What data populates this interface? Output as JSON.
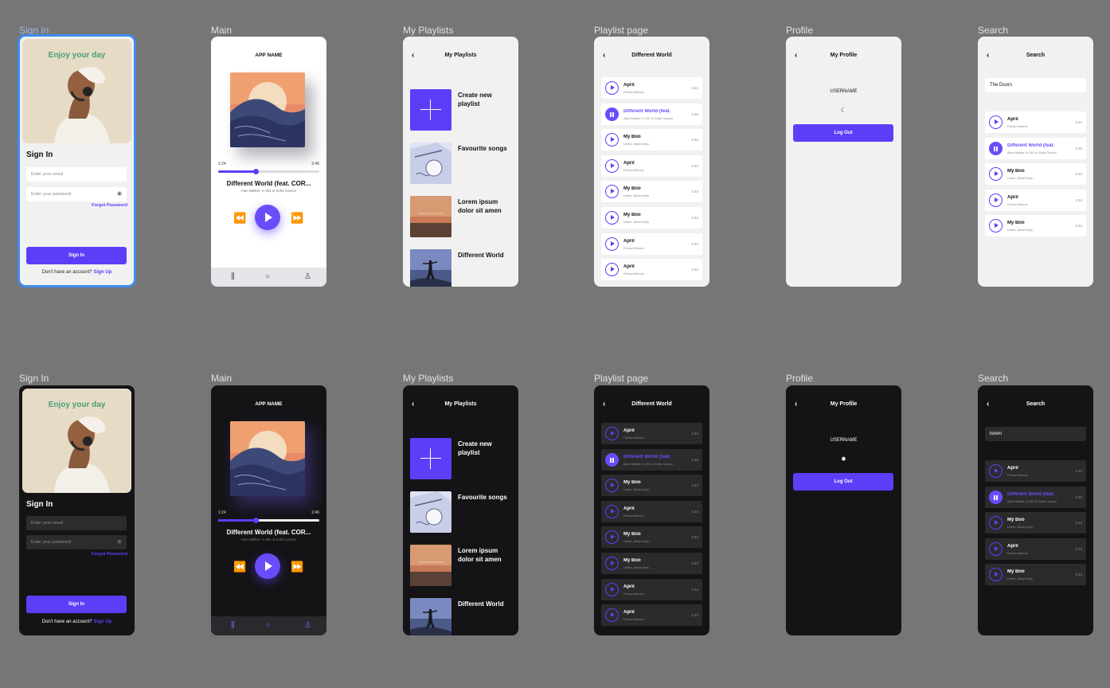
{
  "colors": {
    "accent": "#5b3ff8",
    "canvas": "#767676",
    "light_bg": "#f1f1f2",
    "dark_bg": "#141416"
  },
  "frame_labels": {
    "sign_in": "Sign In",
    "main": "Main",
    "my_playlists": "My Playlists",
    "playlist_page": "Playlist page",
    "profile": "Profile",
    "search": "Search"
  },
  "signin": {
    "hero_text": "Enjoy your day",
    "title": "Sign In",
    "email_placeholder": "Enter your email",
    "password_placeholder": "Enter your password",
    "forgot": "Forgot Password",
    "button": "Sign In",
    "no_account": "Don't have an account?",
    "signup": "Sign Up"
  },
  "main": {
    "app_name": "APP NAME",
    "elapsed": "1:24",
    "duration": "2:46",
    "progress": 0.37,
    "song_title": "Different World (feat. COR...",
    "song_artist": "Alan Walker, K-391 & Sofia Carson",
    "tabs": [
      "library-icon",
      "search-icon",
      "profile-icon"
    ]
  },
  "playlists": {
    "title": "My Playlists",
    "items": [
      "Create new playlist",
      "Favourite songs",
      "Lorem ipsum dolor sit amen",
      "Different World"
    ]
  },
  "playlist_page": {
    "title": "Different World",
    "tracks": [
      {
        "title": "April",
        "artist": "Fienso Bersori",
        "dur": "4:24"
      },
      {
        "title": "Different World (feat.",
        "artist": "Alan Walker, K-391 & Sofia Carson",
        "dur": "2:46",
        "active": true
      },
      {
        "title": "My Boo",
        "artist": "Usher, Alicia Keys",
        "dur": "3:43"
      },
      {
        "title": "April",
        "artist": "Fienso Bersori",
        "dur": "4:24"
      },
      {
        "title": "My Boo",
        "artist": "Usher, Alicia Keys",
        "dur": "3:43"
      },
      {
        "title": "My Boo",
        "artist": "Usher, Alicia Keys",
        "dur": "3:43"
      },
      {
        "title": "April",
        "artist": "Fienso Bersori",
        "dur": "4:24"
      },
      {
        "title": "April",
        "artist": "Fienso Bersori",
        "dur": "4:24"
      }
    ]
  },
  "profile": {
    "title": "My Profile",
    "username": "USERNAME",
    "logout": "Log Out"
  },
  "search": {
    "title": "Search",
    "query_light": "The Doors",
    "query_dark": "lorem",
    "results": [
      {
        "title": "April",
        "artist": "Fienso Bersori",
        "dur": "4:24"
      },
      {
        "title": "Different World (feat.",
        "artist": "Alan Walker, K-391 & Sofia Carson",
        "dur": "2:46",
        "active": true
      },
      {
        "title": "My Boo",
        "artist": "Usher, Alicia Keys",
        "dur": "3:43"
      },
      {
        "title": "April",
        "artist": "Fienso Bersori",
        "dur": "4:24"
      },
      {
        "title": "My Boo",
        "artist": "Usher, Alicia Keys",
        "dur": "3:43"
      }
    ]
  }
}
